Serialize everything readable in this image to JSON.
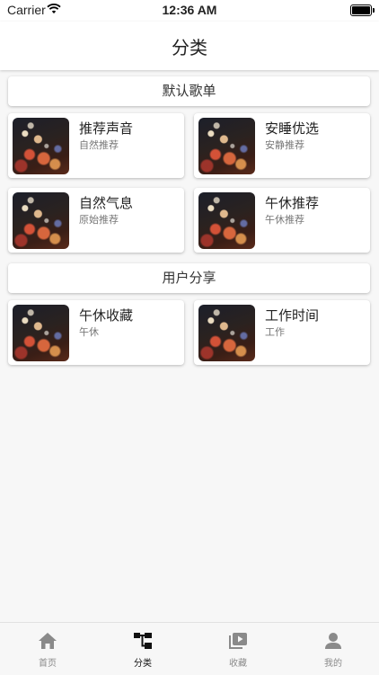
{
  "status": {
    "carrier": "Carrier",
    "time": "12:36 AM"
  },
  "nav": {
    "title": "分类"
  },
  "sections": [
    {
      "title": "默认歌单",
      "cards": [
        {
          "title": "推荐声音",
          "subtitle": "自然推荐"
        },
        {
          "title": "安睡优选",
          "subtitle": "安静推荐"
        },
        {
          "title": "自然气息",
          "subtitle": "原始推荐"
        },
        {
          "title": "午休推荐",
          "subtitle": "午休推荐"
        }
      ]
    },
    {
      "title": "用户分享",
      "cards": [
        {
          "title": "午休收藏",
          "subtitle": "午休"
        },
        {
          "title": "工作时间",
          "subtitle": "工作"
        }
      ]
    }
  ],
  "tabbar": {
    "items": [
      {
        "label": "首页",
        "icon": "home-icon"
      },
      {
        "label": "分类",
        "icon": "category-icon",
        "active": true
      },
      {
        "label": "收藏",
        "icon": "playlist-icon"
      },
      {
        "label": "我的",
        "icon": "person-icon"
      }
    ]
  },
  "colors": {
    "active_tab": "#111111",
    "inactive_tab": "#8a8a8a",
    "background": "#f7f7f7"
  }
}
